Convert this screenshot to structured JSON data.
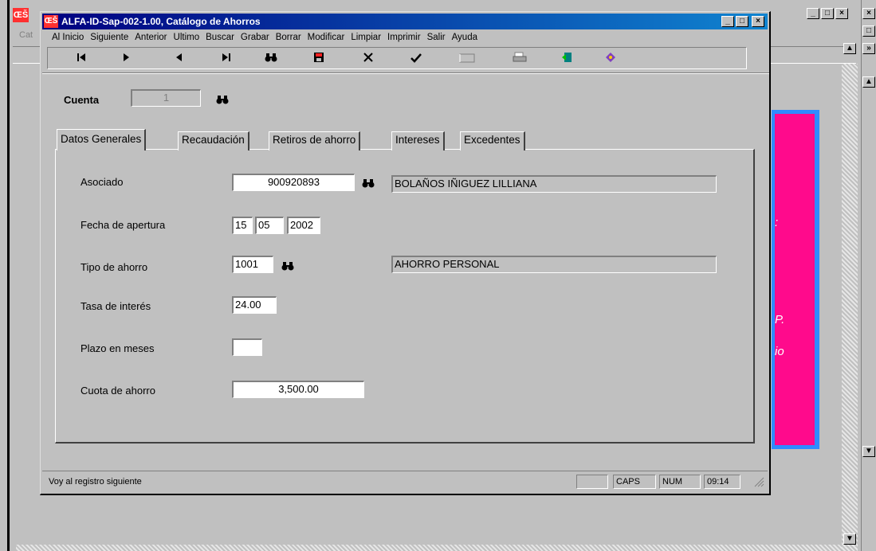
{
  "parent": {
    "label": "Cat",
    "icon_text": "ŒŠ"
  },
  "dialog": {
    "title": "ALFA-ID-Sap-002-1.00, Catálogo de Ahorros",
    "icon_text": "ŒŠ",
    "window_controls": {
      "minimize": "_",
      "maximize": "□",
      "close": "×"
    }
  },
  "menu": {
    "items": [
      "Al Inicio",
      "Siguiente",
      "Anterior",
      "Ultimo",
      "Buscar",
      "Grabar",
      "Borrar",
      "Modificar",
      "Limpiar",
      "Imprimir",
      "Salir",
      "Ayuda"
    ]
  },
  "toolbar": {
    "buttons": [
      {
        "name": "first-record-icon",
        "glyph": "⏮"
      },
      {
        "name": "next-record-icon",
        "glyph": "▶"
      },
      {
        "name": "previous-record-icon",
        "glyph": "◀"
      },
      {
        "name": "last-record-icon",
        "glyph": "⏭"
      },
      {
        "name": "search-binoculars-icon",
        "glyph": "👓"
      },
      {
        "name": "save-disk-icon",
        "glyph": "💾"
      },
      {
        "name": "delete-x-icon",
        "glyph": "✕"
      },
      {
        "name": "modify-check-icon",
        "glyph": "✔"
      },
      {
        "name": "clear-icon",
        "glyph": ""
      },
      {
        "name": "print-icon",
        "glyph": "🖨"
      },
      {
        "name": "exit-door-icon",
        "glyph": "🚪"
      },
      {
        "name": "help-book-icon",
        "glyph": "📘"
      }
    ]
  },
  "header": {
    "cuenta_label": "Cuenta",
    "cuenta_value": "1"
  },
  "tabs": [
    "Datos Generales",
    "Recaudación",
    "Retiros de ahorro",
    "Intereses",
    "Excedentes"
  ],
  "form": {
    "asociado_label": "Asociado",
    "asociado_id": "900920893",
    "asociado_name": "BOLAÑOS IÑIGUEZ LILLIANA",
    "fecha_label": "Fecha de apertura",
    "fecha_day": "15",
    "fecha_month": "05",
    "fecha_year": "2002",
    "tipo_label": "Tipo de ahorro",
    "tipo_code": "1001",
    "tipo_desc": "AHORRO PERSONAL",
    "tasa_label": "Tasa de interés",
    "tasa_value": "24.00",
    "plazo_label": "Plazo en meses",
    "plazo_value": "",
    "cuota_label": "Cuota de ahorro",
    "cuota_value": "3,500.00"
  },
  "status": {
    "message": "Voy al registro siguiente",
    "caps": "CAPS",
    "num": "NUM",
    "time": "09:14"
  },
  "background_panel": {
    "text_1": ":",
    "text_2": "P.",
    "text_3": "io"
  },
  "colors": {
    "title_gradient_start": "#000080",
    "title_gradient_end": "#1084d0",
    "panel_magenta": "#ff0a8c",
    "panel_frame_blue": "#2f8bff"
  }
}
